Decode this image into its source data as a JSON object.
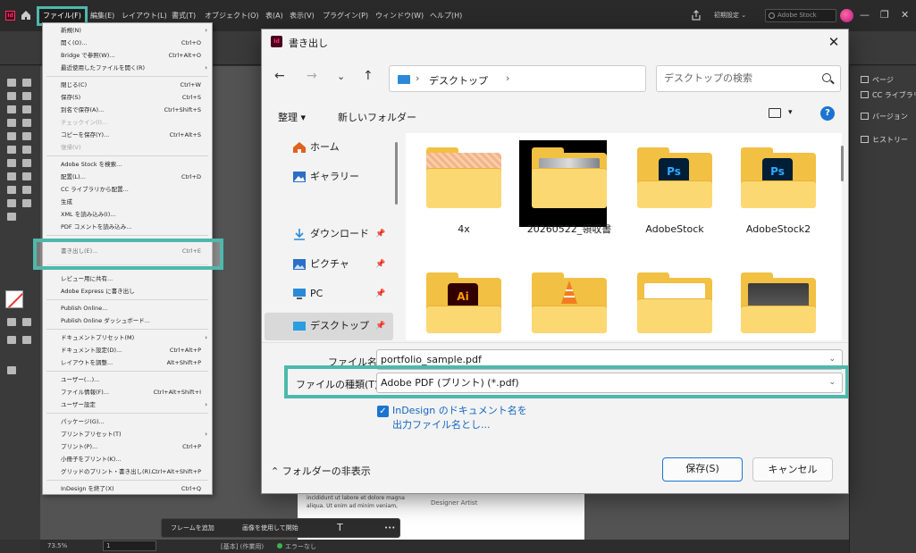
{
  "menubar": {
    "app_logo": "Id",
    "items": [
      "ファイル(F)",
      "編集(E)",
      "レイアウト(L)",
      "書式(T)",
      "オブジェクト(O)",
      "表(A)",
      "表示(V)",
      "プラグイン(P)",
      "ウィンドウ(W)",
      "ヘルプ(H)"
    ],
    "workspace": "初期設定 ⌄",
    "stock_search_placeholder": "Adobe Stock",
    "window_controls": [
      "—",
      "❐",
      "✕"
    ]
  },
  "file_menu": {
    "items": [
      {
        "label": "新規(N)",
        "shortcut": "",
        "submenu": true,
        "disabled": false
      },
      {
        "label": "開く(O)...",
        "shortcut": "Ctrl+O",
        "submenu": false,
        "disabled": false
      },
      {
        "label": "Bridge で参照(W)...",
        "shortcut": "Ctrl+Alt+O",
        "submenu": false,
        "disabled": false
      },
      {
        "label": "最近使用したファイルを開く(R)",
        "shortcut": "",
        "submenu": true,
        "disabled": false
      },
      {
        "label": "閉じる(C)",
        "shortcut": "Ctrl+W",
        "submenu": false,
        "disabled": false
      },
      {
        "label": "保存(S)",
        "shortcut": "Ctrl+S",
        "submenu": false,
        "disabled": false
      },
      {
        "label": "別名で保存(A)...",
        "shortcut": "Ctrl+Shift+S",
        "submenu": false,
        "disabled": false
      },
      {
        "label": "チェックイン(I)...",
        "shortcut": "",
        "submenu": false,
        "disabled": true
      },
      {
        "label": "コピーを保存(Y)...",
        "shortcut": "Ctrl+Alt+S",
        "submenu": false,
        "disabled": false
      },
      {
        "label": "復帰(V)",
        "shortcut": "",
        "submenu": false,
        "disabled": true
      },
      {
        "label": "Adobe Stock を検索...",
        "shortcut": "",
        "submenu": false,
        "disabled": false
      },
      {
        "label": "配置(L)...",
        "shortcut": "Ctrl+D",
        "submenu": false,
        "disabled": false
      },
      {
        "label": "CC ライブラリから配置...",
        "shortcut": "",
        "submenu": false,
        "disabled": false
      },
      {
        "label": "生成",
        "shortcut": "",
        "submenu": false,
        "disabled": false
      },
      {
        "label": "XML を読み込み(I)...",
        "shortcut": "",
        "submenu": false,
        "disabled": false
      },
      {
        "label": "PDF コメントを読み込み...",
        "shortcut": "",
        "submenu": false,
        "disabled": false
      },
      {
        "label": "書き出し(E)...",
        "shortcut": "Ctrl+E",
        "submenu": false,
        "disabled": false
      },
      {
        "label": "レビュー用に共有...",
        "shortcut": "",
        "submenu": false,
        "disabled": false
      },
      {
        "label": "Adobe Express に書き出し",
        "shortcut": "",
        "submenu": false,
        "disabled": false
      },
      {
        "label": "Publish Online...",
        "shortcut": "",
        "submenu": false,
        "disabled": false
      },
      {
        "label": "Publish Online ダッシュボード...",
        "shortcut": "",
        "submenu": false,
        "disabled": false
      },
      {
        "label": "ドキュメントプリセット(M)",
        "shortcut": "",
        "submenu": true,
        "disabled": false
      },
      {
        "label": "ドキュメント設定(D)...",
        "shortcut": "Ctrl+Alt+P",
        "submenu": false,
        "disabled": false
      },
      {
        "label": "レイアウトを調整...",
        "shortcut": "Alt+Shift+P",
        "submenu": false,
        "disabled": false
      },
      {
        "label": "ユーザー(...)...",
        "shortcut": "",
        "submenu": false,
        "disabled": false
      },
      {
        "label": "ファイル情報(F)...",
        "shortcut": "Ctrl+Alt+Shift+I",
        "submenu": false,
        "disabled": false
      },
      {
        "label": "ユーザー設定",
        "shortcut": "",
        "submenu": true,
        "disabled": false
      },
      {
        "label": "パッケージ(G)...",
        "shortcut": "",
        "submenu": false,
        "disabled": false
      },
      {
        "label": "プリントプリセット(T)",
        "shortcut": "",
        "submenu": true,
        "disabled": false
      },
      {
        "label": "プリント(P)...",
        "shortcut": "Ctrl+P",
        "submenu": false,
        "disabled": false
      },
      {
        "label": "小冊子をプリント(K)...",
        "shortcut": "",
        "submenu": false,
        "disabled": false
      },
      {
        "label": "グリッドのプリント・書き出し(R)...",
        "shortcut": "Ctrl+Alt+Shift+P",
        "submenu": false,
        "disabled": false
      },
      {
        "label": "InDesign を終了(X)",
        "shortcut": "Ctrl+Q",
        "submenu": false,
        "disabled": false
      }
    ]
  },
  "dialog": {
    "title": "書き出し",
    "close_glyph": "✕",
    "nav": {
      "back": "←",
      "forward": "→",
      "recent": "⌄",
      "up": "↑",
      "refresh": "↻"
    },
    "address": "デスクトップ",
    "search_placeholder": "デスクトップの検索",
    "cmd": {
      "organize": "整理 ▾",
      "new_folder": "新しいフォルダー",
      "view_caret": "▾",
      "help": "?"
    },
    "nav_pane": [
      {
        "label": "ホーム",
        "pinned": false
      },
      {
        "label": "ギャラリー",
        "pinned": false
      },
      {
        "label": "ダウンロード",
        "pinned": true
      },
      {
        "label": "ピクチャ",
        "pinned": true
      },
      {
        "label": "PC",
        "pinned": true
      },
      {
        "label": "デスクトップ",
        "pinned": true
      }
    ],
    "pin_glyph": "📌",
    "files": [
      {
        "label": "4x",
        "icon": "pattern-folder-icon"
      },
      {
        "label": "20260522_領収書",
        "icon": "image-folder-icon"
      },
      {
        "label": "AdobeStock",
        "icon": "ps-folder-icon"
      },
      {
        "label": "AdobeStock2",
        "icon": "ps-folder-icon"
      },
      {
        "label": "",
        "icon": "ai-folder-icon"
      },
      {
        "label": "",
        "icon": "vlc-folder-icon"
      },
      {
        "label": "",
        "icon": "folder-icon"
      },
      {
        "label": "",
        "icon": "screenshot-folder-icon"
      }
    ],
    "badges": {
      "ps": "Ps",
      "ai": "Ai"
    },
    "filename_label": "ファイル名(N):",
    "filename_value": "portfolio_sample.pdf",
    "filetype_label": "ファイルの種類(T):",
    "filetype_value": "Adobe PDF (プリント) (*.pdf)",
    "caret": "⌄",
    "checkbox_checked": "✓",
    "idml_text": "InDesign のドキュメント名を出力ファイル名とし...",
    "hide_folders": "⌃ フォルダーの非表示",
    "save_label": "保存(S)",
    "cancel_label": "キャンセル"
  },
  "right_panel": {
    "items": [
      "ページ",
      "CC ライブラリ",
      "バージョン",
      "ヒストリー"
    ]
  },
  "document": {
    "body_text": "incididunt ut labore et dolore magna aliqua. Ut enim ad minim veniam,",
    "designer": "Designer Artist"
  },
  "floating_bar": {
    "add_frame": "フレームを追加",
    "use_image": "画像を使用して開始",
    "type_tool": "T",
    "more": "•••"
  },
  "statusbar": {
    "zoom": "73.5%",
    "page": "1",
    "mode": "[基本] (作業用)",
    "errors": "エラーなし"
  },
  "colors": {
    "highlight": "#4fb8ac",
    "accent_blue": "#1b74d1",
    "folder": "#f2c042"
  }
}
